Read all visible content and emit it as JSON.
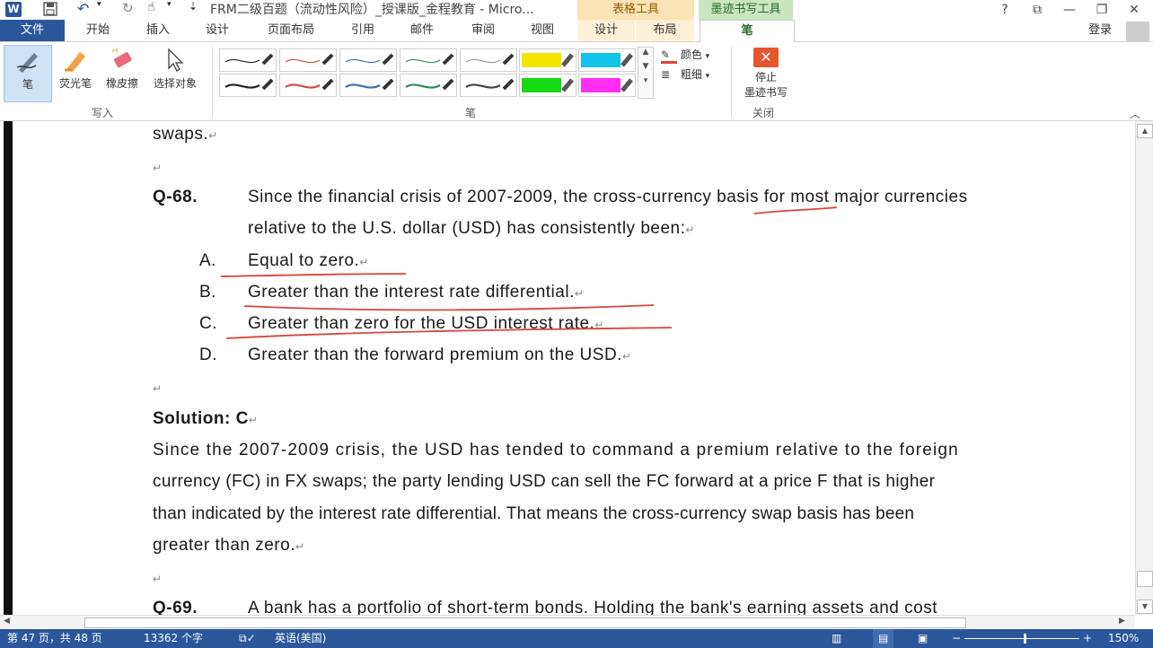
{
  "titlebar": {
    "app_icon": "W",
    "doc_title": "FRM二级百题（流动性风险）_授课版_金程教育 - Micro...",
    "context_table_tools": "表格工具",
    "context_ink_tools": "墨迹书写工具",
    "help": "?",
    "restore_ribbon": "⧉",
    "minimize": "—",
    "maximize": "❐",
    "close": "✕",
    "undo": "↶",
    "redo": "↻",
    "touch": "☝",
    "customize": "⇣"
  },
  "tabs": [
    {
      "label": "文件"
    },
    {
      "label": "开始"
    },
    {
      "label": "插入"
    },
    {
      "label": "设计"
    },
    {
      "label": "页面布局"
    },
    {
      "label": "引用"
    },
    {
      "label": "邮件"
    },
    {
      "label": "审阅"
    },
    {
      "label": "视图"
    },
    {
      "label": "设计"
    },
    {
      "label": "布局"
    },
    {
      "label": "笔"
    }
  ],
  "account": {
    "login": "登录"
  },
  "ribbon": {
    "write_group": {
      "label": "写入",
      "tools": [
        {
          "label": "笔",
          "icon": "pen-icon"
        },
        {
          "label": "荧光笔",
          "icon": "highlighter-icon"
        },
        {
          "label": "橡皮擦",
          "icon": "eraser-icon"
        },
        {
          "label": "选择对象",
          "icon": "select-arrow-icon"
        }
      ]
    },
    "pen_group": {
      "label": "笔",
      "colors": [
        "#222222",
        "#d44a3a",
        "#3a6fb0",
        "#2e8b57",
        "#444444",
        "#f2e600",
        "#11c4ea",
        "#16d916",
        "#ff2ef2"
      ],
      "color_cmd": "颜色",
      "weight_cmd": "粗细"
    },
    "close_group": {
      "label": "关闭",
      "stop_line1": "停止",
      "stop_line2": "墨迹书写"
    }
  },
  "document": {
    "line_swaps": "swaps.",
    "q68_label": "Q-68.",
    "q68_line1": "Since the financial crisis of 2007-2009, the cross-currency basis for most major currencies",
    "q68_line2": "relative to the U.S. dollar (USD) has consistently been:",
    "options": [
      {
        "letter": "A.",
        "text": "Equal to zero."
      },
      {
        "letter": "B.",
        "text": "Greater than the interest rate differential."
      },
      {
        "letter": "C.",
        "text": "Greater than zero for the USD interest rate."
      },
      {
        "letter": "D.",
        "text": "Greater than the forward premium on the USD."
      }
    ],
    "solution_label": "Solution: C",
    "solution_lines": [
      "Since the 2007-2009 crisis, the USD has tended to command a premium relative to the foreign",
      "currency (FC) in FX swaps; the party lending USD can sell the FC forward at a price F that is higher",
      "than indicated by the interest rate differential. That means the cross-currency swap basis has been",
      "greater than zero."
    ],
    "q69_label": "Q-69.",
    "q69_line1": "A bank has a portfolio of short-term bonds. Holding the bank's earning assets and cost",
    "para_mark": "↵",
    "ink_color": "#d9463a"
  },
  "status": {
    "page": "第 47 页，共 48 页",
    "words": "13362 个字",
    "lang": "英语(美国)",
    "zoom": "150%",
    "zoom_minus": "−",
    "zoom_plus": "+"
  }
}
